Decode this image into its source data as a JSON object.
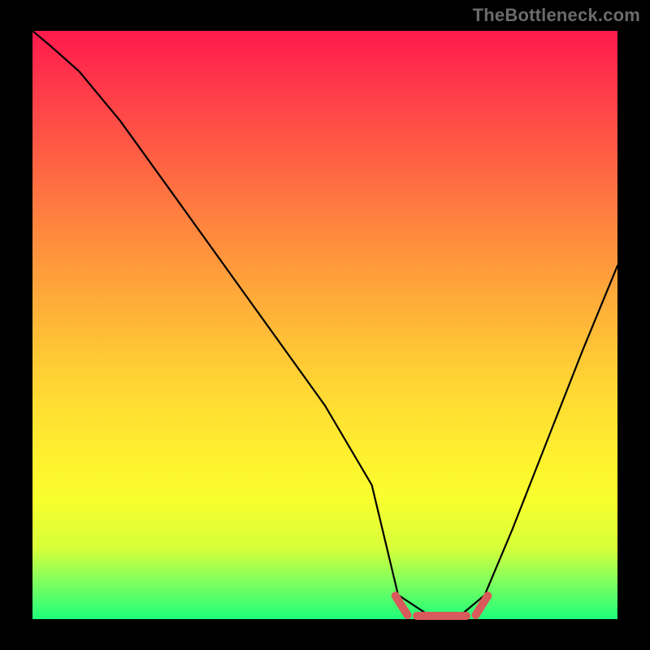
{
  "watermark": "TheBottleneck.com",
  "colors": {
    "frame_bg": "#000000",
    "watermark": "#6b6b6b",
    "curve": "#000000",
    "knee": "#d95a5a"
  },
  "chart_data": {
    "type": "line",
    "title": "",
    "xlabel": "",
    "ylabel": "",
    "xlim": [
      0,
      100
    ],
    "ylim": [
      0,
      100
    ],
    "grid": false,
    "legend": false,
    "gradient_bg": {
      "top": "red",
      "bottom": "green",
      "meaning": "top=high bottleneck, bottom=zero bottleneck"
    },
    "overlay_segment_x_pct": [
      62.5,
      77.3
    ],
    "series": [
      {
        "name": "bottleneck-curve",
        "x": [
          0,
          3,
          8,
          15,
          25,
          38,
          50,
          58,
          62.5,
          68,
          73,
          77.3,
          82,
          88,
          94,
          100
        ],
        "y": [
          100,
          97.5,
          93.1,
          84.7,
          70.9,
          52.9,
          36.3,
          22.8,
          4.1,
          0.5,
          0.5,
          4.1,
          15.2,
          30.4,
          45.6,
          60.1
        ]
      }
    ]
  }
}
